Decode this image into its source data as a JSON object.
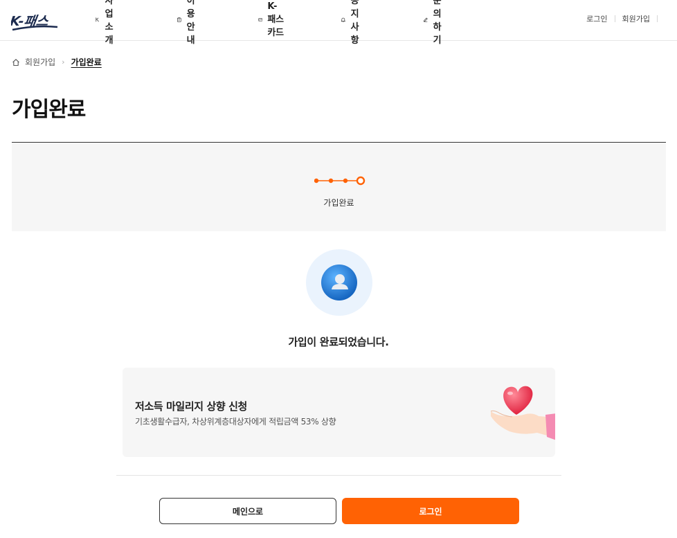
{
  "header": {
    "logo_text": "K-패스",
    "nav": [
      {
        "label": "사업소개",
        "icon": "leaf-k-icon"
      },
      {
        "label": "이용안내",
        "icon": "clipboard-icon"
      },
      {
        "label": "K-패스 카드",
        "icon": "card-icon"
      },
      {
        "label": "공지사항",
        "icon": "bell-icon"
      },
      {
        "label": "문의하기",
        "icon": "pencil-icon"
      }
    ],
    "util": {
      "login": "로그인",
      "signup": "회원가입"
    }
  },
  "breadcrumb": {
    "parent": "회원가입",
    "current": "가입완료"
  },
  "page_title": "가입완료",
  "steps": {
    "total": 4,
    "current": 4,
    "label": "가입완료"
  },
  "message": "가입이 완료되었습니다.",
  "promo": {
    "title": "저소득 마일리지 상향 신청",
    "description": "기초생활수급자, 차상위계층대상자에게 적립금액 53% 상향"
  },
  "buttons": {
    "main": "메인으로",
    "login": "로그인"
  },
  "colors": {
    "accent": "#ff6204",
    "navy": "#1b2a4e",
    "avatar_blue": "#1e88e5"
  }
}
